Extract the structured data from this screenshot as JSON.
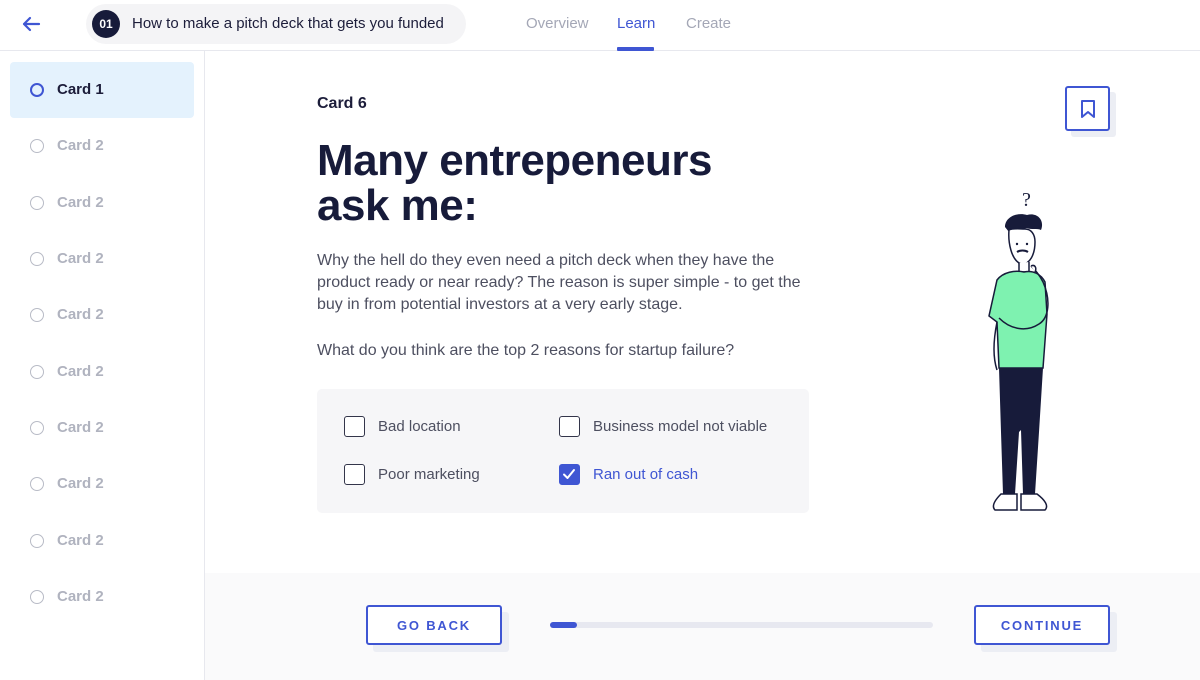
{
  "header": {
    "course_number": "01",
    "course_title": "How to make a pitch deck that gets you funded",
    "tabs": [
      {
        "label": "Overview",
        "active": false
      },
      {
        "label": "Learn",
        "active": true
      },
      {
        "label": "Create",
        "active": false
      }
    ],
    "back_icon": "arrow-left-icon"
  },
  "sidebar": {
    "items": [
      {
        "label": "Card 1",
        "active": true
      },
      {
        "label": "Card 2",
        "active": false
      },
      {
        "label": "Card 2",
        "active": false
      },
      {
        "label": "Card 2",
        "active": false
      },
      {
        "label": "Card 2",
        "active": false
      },
      {
        "label": "Card 2",
        "active": false
      },
      {
        "label": "Card 2",
        "active": false
      },
      {
        "label": "Card 2",
        "active": false
      },
      {
        "label": "Card 2",
        "active": false
      },
      {
        "label": "Card 2",
        "active": false
      }
    ]
  },
  "card": {
    "label": "Card 6",
    "headline_line1": "Many entrepeneurs",
    "headline_line2": "ask me:",
    "paragraph": "Why the hell do they even need a pitch deck when they have the product ready or near ready? The reason is super simple - to get the buy in from potential investors at a very early stage.",
    "question": "What do you think are the top 2 reasons for startup failure?",
    "bookmark_icon": "bookmark-icon",
    "options": [
      {
        "label": "Bad location",
        "checked": false
      },
      {
        "label": "Business model not viable",
        "checked": false
      },
      {
        "label": "Poor marketing",
        "checked": false
      },
      {
        "label": "Ran out of cash",
        "checked": true
      }
    ],
    "illustration_text": "?"
  },
  "footer": {
    "back_label": "GO BACK",
    "continue_label": "CONTINUE",
    "progress": 0.07
  },
  "colors": {
    "accent": "#3f56d3",
    "active_bg": "#e4f2fd",
    "dark_text": "#171b3a",
    "shirt": "#7ef2b0"
  }
}
